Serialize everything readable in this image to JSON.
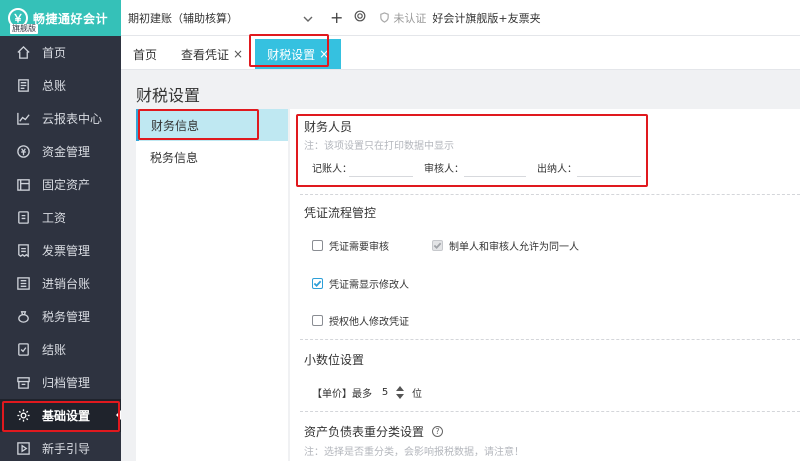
{
  "app": {
    "logo_text": "畅捷通好会计",
    "edition_badge": "旗舰版"
  },
  "sidebar": {
    "items": [
      {
        "label": "首页",
        "icon": "home-icon"
      },
      {
        "label": "总账",
        "icon": "ledger-icon"
      },
      {
        "label": "云报表中心",
        "icon": "chart-line-icon"
      },
      {
        "label": "资金管理",
        "icon": "money-icon"
      },
      {
        "label": "固定资产",
        "icon": "asset-icon"
      },
      {
        "label": "工资",
        "icon": "salary-icon"
      },
      {
        "label": "发票管理",
        "icon": "invoice-icon"
      },
      {
        "label": "进销台账",
        "icon": "inventory-icon"
      },
      {
        "label": "税务管理",
        "icon": "tax-icon"
      },
      {
        "label": "结账",
        "icon": "checkout-icon"
      },
      {
        "label": "归档管理",
        "icon": "archive-icon"
      },
      {
        "label": "基础设置",
        "icon": "gear-icon",
        "active": true
      },
      {
        "label": "新手引导",
        "icon": "play-icon"
      }
    ]
  },
  "topbar": {
    "account": "期初建账（辅助核算）",
    "certification": "未认证",
    "edition": "好会计旗舰版+友票夹"
  },
  "tabs": [
    {
      "label": "首页",
      "closable": false
    },
    {
      "label": "查看凭证",
      "closable": true
    },
    {
      "label": "财税设置",
      "closable": true,
      "active": true
    }
  ],
  "page": {
    "title": "财税设置",
    "left_menu": [
      {
        "label": "财务信息",
        "active": true
      },
      {
        "label": "税务信息"
      }
    ]
  },
  "finance": {
    "section_title": "财务人员",
    "note": "注：该项设置只在打印数据中显示",
    "fields": [
      {
        "label": "记账人：",
        "value": ""
      },
      {
        "label": "审核人：",
        "value": ""
      },
      {
        "label": "出纳人：",
        "value": ""
      }
    ]
  },
  "voucher": {
    "section_title": "凭证流程管控",
    "options": [
      {
        "label": "凭证需要审核",
        "checked": false
      },
      {
        "label": "制单人和审核人允许为同一人",
        "checked": true,
        "disabled": true
      },
      {
        "label": "凭证需显示修改人",
        "checked": true
      },
      {
        "label": "授权他人修改凭证",
        "checked": false
      }
    ]
  },
  "decimal": {
    "section_title": "小数位设置",
    "prefix": "【单价】最多",
    "value": "5",
    "suffix": "位"
  },
  "balance": {
    "section_title": "资产负债表重分类设置",
    "note": "注：选择是否重分类，会影响报税数据，请注意！"
  },
  "colors": {
    "sidebar_bg": "#2e3340",
    "brand": "#35c1b8",
    "active_tab": "#35c1e0",
    "highlight": "#e0191e"
  }
}
